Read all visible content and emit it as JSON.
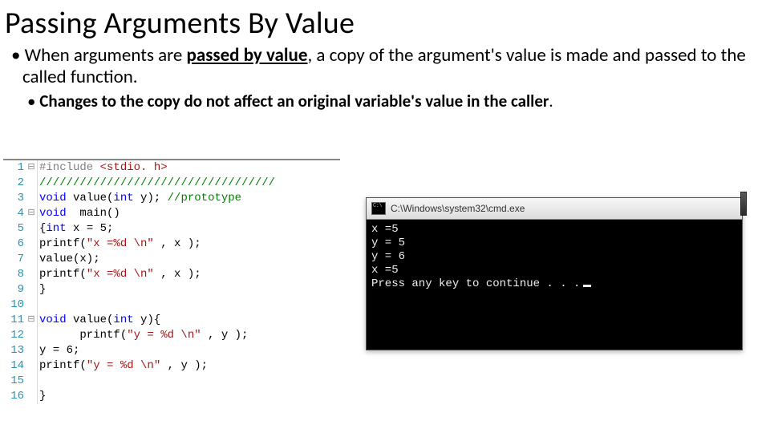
{
  "title": "Passing Arguments By Value",
  "bullet1_pre": "When arguments are ",
  "bullet1_em": "passed by value",
  "bullet1_post": ", a copy of the argument's value is made and passed to the called function.",
  "sub1_text": "Changes to the copy do not affect an original variable's value in the caller",
  "sub1_tail": ".",
  "code": {
    "lines": [
      {
        "n": "1",
        "fold": "⊟",
        "seg": [
          [
            "pp",
            "#include "
          ],
          [
            "inc",
            "<stdio. h>"
          ]
        ]
      },
      {
        "n": "2",
        "fold": " ",
        "seg": [
          [
            "cmt",
            "///////////////////////////////////"
          ]
        ]
      },
      {
        "n": "3",
        "fold": " ",
        "seg": [
          [
            "kw",
            "void"
          ],
          [
            "",
            " value("
          ],
          [
            "kw",
            "int"
          ],
          [
            "",
            " y); "
          ],
          [
            "cmt",
            "//prototype"
          ]
        ]
      },
      {
        "n": "4",
        "fold": "⊟",
        "seg": [
          [
            "kw",
            "void"
          ],
          [
            "",
            "  main()"
          ]
        ]
      },
      {
        "n": "5",
        "fold": " ",
        "seg": [
          [
            "",
            "{"
          ],
          [
            "kw",
            "int"
          ],
          [
            "",
            " x = 5;"
          ]
        ]
      },
      {
        "n": "6",
        "fold": " ",
        "seg": [
          [
            "",
            "printf("
          ],
          [
            "str",
            "\"x =%d \\n\""
          ],
          [
            "",
            " , x );"
          ]
        ]
      },
      {
        "n": "7",
        "fold": " ",
        "seg": [
          [
            "",
            "value(x);"
          ]
        ]
      },
      {
        "n": "8",
        "fold": " ",
        "seg": [
          [
            "",
            "printf("
          ],
          [
            "str",
            "\"x =%d \\n\""
          ],
          [
            "",
            " , x );"
          ]
        ]
      },
      {
        "n": "9",
        "fold": " ",
        "seg": [
          [
            "",
            "}"
          ]
        ]
      },
      {
        "n": "10",
        "fold": " ",
        "seg": [
          [
            "",
            ""
          ]
        ]
      },
      {
        "n": "11",
        "fold": "⊟",
        "seg": [
          [
            "kw",
            "void"
          ],
          [
            "",
            " value("
          ],
          [
            "kw",
            "int"
          ],
          [
            "",
            " y){"
          ]
        ]
      },
      {
        "n": "12",
        "fold": " ",
        "seg": [
          [
            "",
            "      printf("
          ],
          [
            "str",
            "\"y = %d \\n\""
          ],
          [
            "",
            " , y );"
          ]
        ]
      },
      {
        "n": "13",
        "fold": " ",
        "seg": [
          [
            "",
            "y = 6;"
          ]
        ]
      },
      {
        "n": "14",
        "fold": " ",
        "seg": [
          [
            "",
            "printf("
          ],
          [
            "str",
            "\"y = %d \\n\""
          ],
          [
            "",
            " , y );"
          ]
        ]
      },
      {
        "n": "15",
        "fold": " ",
        "seg": [
          [
            "",
            ""
          ]
        ]
      },
      {
        "n": "16",
        "fold": " ",
        "seg": [
          [
            "",
            "}"
          ]
        ]
      }
    ]
  },
  "console": {
    "title": "C:\\Windows\\system32\\cmd.exe",
    "lines": [
      "x =5",
      "y = 5",
      "y = 6",
      "x =5",
      "Press any key to continue . . ."
    ]
  }
}
